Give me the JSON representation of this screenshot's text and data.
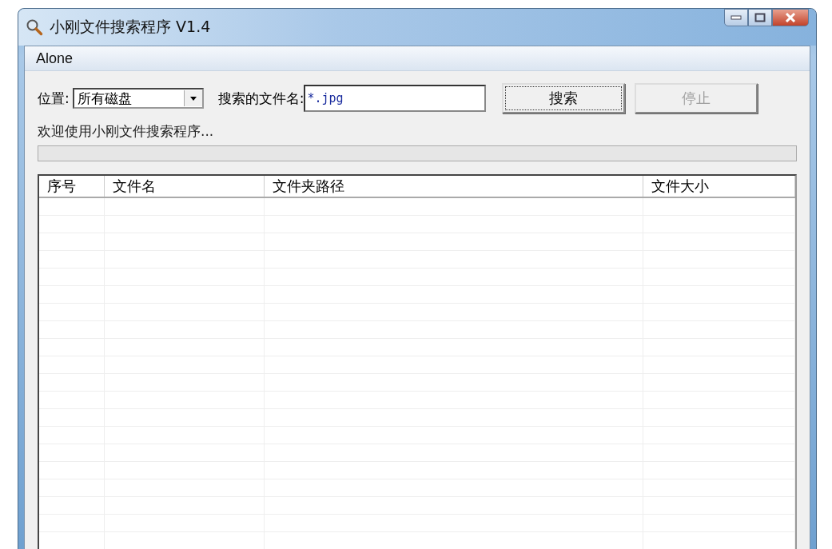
{
  "window": {
    "title": "小刚文件搜索程序 V1.4"
  },
  "menu": [
    "Alone"
  ],
  "location": {
    "label": "位置:",
    "value": "所有磁盘"
  },
  "filename": {
    "label": "搜索的文件名:",
    "value": "*.jpg"
  },
  "buttons": [
    {
      "label": "搜索",
      "disabled": false
    },
    {
      "label": "停止",
      "disabled": true
    }
  ],
  "status": "欢迎使用小刚文件搜索程序...",
  "progress": {
    "level": 0
  },
  "table": {
    "columns": [
      "序号",
      "文件名",
      "文件夹路径",
      "文件大小"
    ]
  }
}
